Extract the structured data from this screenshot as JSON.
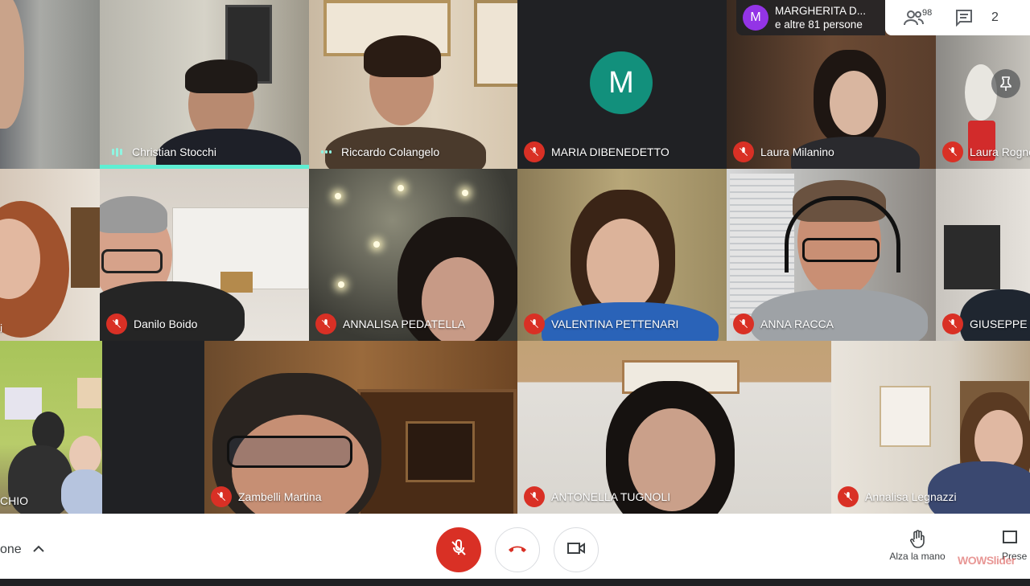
{
  "participants": [
    {
      "name": "",
      "state": "none"
    },
    {
      "name": "Christian Stocchi",
      "state": "speaking"
    },
    {
      "name": "Riccardo Colangelo",
      "state": "speaking"
    },
    {
      "name": "MARIA DIBENEDETTO",
      "state": "muted",
      "avatar_letter": "M"
    },
    {
      "name": "Laura Milanino",
      "state": "muted"
    },
    {
      "name": "Laura Rogno",
      "state": "muted"
    },
    {
      "name": "i",
      "state": "none"
    },
    {
      "name": "Danilo Boido",
      "state": "muted"
    },
    {
      "name": "ANNALISA PEDATELLA",
      "state": "muted"
    },
    {
      "name": "VALENTINA PETTENARI",
      "state": "muted"
    },
    {
      "name": "ANNA RACCA",
      "state": "muted"
    },
    {
      "name": "GIUSEPPE C",
      "state": "muted"
    },
    {
      "name": "CHIO",
      "state": "none"
    },
    {
      "name": "Zambelli Martina",
      "state": "muted"
    },
    {
      "name": "ANTONELLA TUGNOLI",
      "state": "muted"
    },
    {
      "name": "Annalisa Legnazzi",
      "state": "muted"
    }
  ],
  "presenter_chip": {
    "letter": "M",
    "name": "MARGHERITA D...",
    "others": "e altre 81 persone"
  },
  "topbar": {
    "people_count": "98",
    "people_icon": "people-icon",
    "chat_icon": "chat-icon",
    "clock": "2"
  },
  "pin_icon": "pin-icon",
  "bottom": {
    "present_label": "one",
    "mic_icon": "mic-off-icon",
    "hangup_icon": "hangup-icon",
    "camera_icon": "camera-icon",
    "raise_hand_label": "Alza la mano",
    "present_right_label": "Prese",
    "watermark": "WOWSlider"
  },
  "colors": {
    "muted_red": "#d93025",
    "speaking": "#5eefd3",
    "avatar_teal": "#12907c",
    "chip_purple": "#9334e6"
  }
}
